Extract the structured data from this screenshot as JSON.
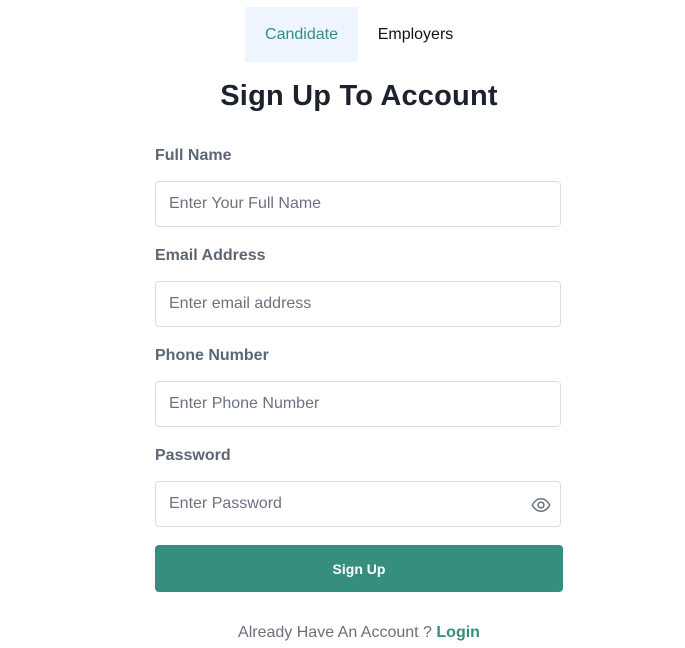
{
  "tabs": [
    {
      "label": "Candidate"
    },
    {
      "label": "Employers"
    }
  ],
  "title": "Sign Up To Account",
  "fields": {
    "full_name": {
      "label": "Full Name",
      "placeholder": "Enter Your Full Name",
      "value": ""
    },
    "email": {
      "label": "Email Address",
      "placeholder": "Enter email address",
      "value": ""
    },
    "phone": {
      "label": "Phone Number",
      "placeholder": "Enter Phone Number",
      "value": ""
    },
    "password": {
      "label": "Password",
      "placeholder": "Enter Password",
      "value": "",
      "toggle_icon": "eye-icon"
    }
  },
  "submit_label": "Sign Up",
  "footer": {
    "prompt": "Already Have An Account ? ",
    "link": "Login"
  },
  "colors": {
    "accent": "#368e7f",
    "active_tab_bg": "#eef5ff",
    "title": "#1b222d",
    "label": "#5d6673",
    "border": "#d9dde2"
  }
}
